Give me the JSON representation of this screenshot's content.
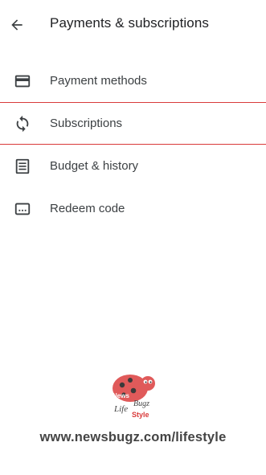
{
  "header": {
    "back_icon": "arrow-back-icon",
    "title": "Payments & subscriptions"
  },
  "menu": {
    "items": [
      {
        "label": "Payment methods",
        "icon": "credit-card-icon"
      },
      {
        "label": "Subscriptions",
        "icon": "sync-icon",
        "highlighted": true
      },
      {
        "label": "Budget & history",
        "icon": "receipt-list-icon"
      },
      {
        "label": "Redeem code",
        "icon": "redeem-code-icon"
      }
    ]
  },
  "watermark": {
    "logo_text_top": "News",
    "logo_text_left": "Life",
    "logo_text_right": "Bugz",
    "logo_text_bottom": "Style",
    "url": "www.newsbugz.com/lifestyle",
    "highlight_color": "#d93a3a"
  }
}
